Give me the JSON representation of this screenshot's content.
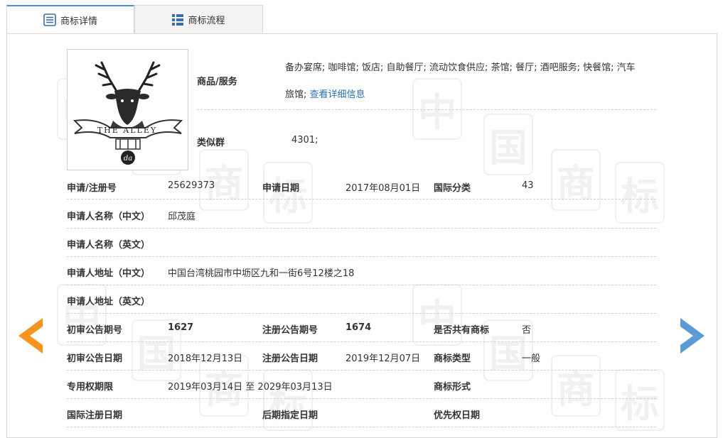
{
  "tabs": [
    {
      "label": "商标详情",
      "icon": "list-detail-icon"
    },
    {
      "label": "商标流程",
      "icon": "grid-flow-icon"
    }
  ],
  "watermark_text": [
    "中",
    "国",
    "商",
    "标"
  ],
  "logo": {
    "brand_text": "THE ALLEY",
    "sub_text": "da"
  },
  "goods": {
    "label": "商品/服务",
    "value": "备办宴席; 咖啡馆; 饭店; 自助餐厅; 流动饮食供应; 茶馆; 餐厅; 酒吧服务; 快餐馆; 汽车",
    "value2": "旅馆;",
    "link": "查看详细信息"
  },
  "similar": {
    "label": "类似群",
    "value": "4301;"
  },
  "rows": {
    "reg_no_label": "申请/注册号",
    "reg_no": "25629373",
    "apply_date_label": "申请日期",
    "apply_date": "2017年08月01日",
    "intl_class_label": "国际分类",
    "intl_class": "43",
    "applicant_cn_label": "申请人名称（中文）",
    "applicant_cn": "邱茂庭",
    "applicant_en_label": "申请人名称（英文）",
    "applicant_en": "",
    "address_cn_label": "申请人地址（中文）",
    "address_cn": "中国台湾桃园市中坜区九和一街6号12楼之18",
    "address_en_label": "申请人地址（英文）",
    "address_en": "",
    "prelim_no_label": "初审公告期号",
    "prelim_no": "1627",
    "reg_pub_no_label": "注册公告期号",
    "reg_pub_no": "1674",
    "shared_label": "是否共有商标",
    "shared": "否",
    "prelim_date_label": "初审公告日期",
    "prelim_date": "2018年12月13日",
    "reg_pub_date_label": "注册公告日期",
    "reg_pub_date": "2019年12月07日",
    "type_label": "商标类型",
    "type": "一般",
    "exclusive_label": "专用权期限",
    "exclusive": "2019年03月14日 至 2029年03月13日",
    "form_label": "商标形式",
    "form": "",
    "intl_reg_date_label": "国际注册日期",
    "intl_reg_date": "",
    "later_date_label": "后期指定日期",
    "later_date": "",
    "priority_date_label": "优先权日期",
    "priority_date": ""
  },
  "colors": {
    "accent": "#4a90d9",
    "prev_arrow": "#f5941e",
    "next_arrow": "#5b9bd5",
    "link": "#2a6fb8"
  }
}
